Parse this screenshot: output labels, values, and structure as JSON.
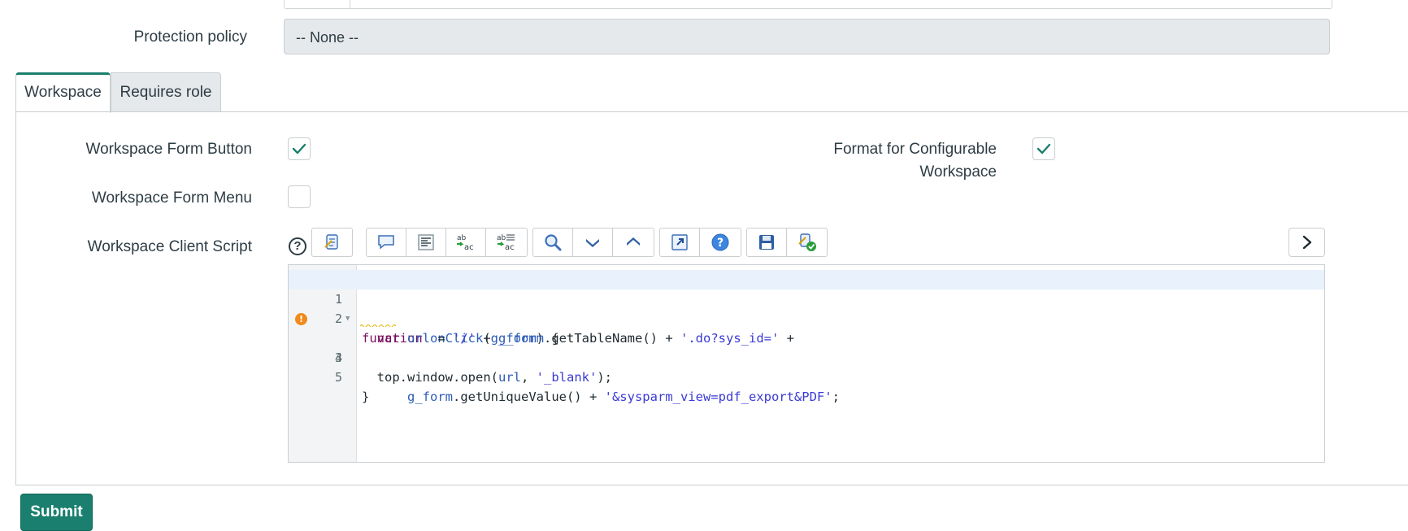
{
  "protection_policy": {
    "label": "Protection policy",
    "value": "-- None --"
  },
  "tabs": [
    {
      "label": "Workspace",
      "active": true
    },
    {
      "label": "Requires role",
      "active": false
    }
  ],
  "fields": {
    "form_button": {
      "label": "Workspace Form Button",
      "checked": true
    },
    "form_menu": {
      "label": "Workspace Form Menu",
      "checked": false
    },
    "configurable": {
      "label_line1": "Format for Configurable",
      "label_line2": "Workspace",
      "checked": true
    },
    "client_script": {
      "label": "Workspace Client Script",
      "help": "?"
    }
  },
  "toolbar": {
    "icons": [
      "script-assist-icon",
      "comment-icon",
      "format-icon",
      "replace-icon",
      "replace-all-icon",
      "search-icon",
      "next-icon",
      "previous-icon",
      "fullscreen-icon",
      "help-icon",
      "save-icon",
      "check-syntax-icon"
    ],
    "expand_icon": "chevron-right-icon"
  },
  "editor": {
    "lines": [
      {
        "n": "1"
      },
      {
        "n": "2"
      },
      {
        "n": "3",
        "warning": true
      },
      {
        "n": "4"
      },
      {
        "n": "5"
      }
    ],
    "tokens": {
      "l1_kw": "function",
      "l1_fn": "onClick",
      "l1_p1": "(",
      "l1_arg": "g_form",
      "l1_p2": ") {",
      "l2_kw": "var",
      "l2_var": "url",
      "l2_op1": " = ",
      "l2_s1": "'/'",
      "l2_op2": " + ",
      "l2_obj": "g_form",
      "l2_call": ".getTableName() + ",
      "l2_s2": "'.do?sys_id='",
      "l2_op3": " +",
      "l3_obj": "g_form",
      "l3_call": ".getUniqueValue() + ",
      "l3_s": "'&sysparm_view=pdf_export&PDF'",
      "l3_end": ";",
      "l4_a": "top.window.open(",
      "l4_var": "url",
      "l4_b": ", ",
      "l4_s": "'_blank'",
      "l4_c": ");",
      "l5": "}"
    }
  },
  "submit_label": "Submit",
  "colors": {
    "accent": "#1a7f6e",
    "warning": "#f08a1c"
  }
}
